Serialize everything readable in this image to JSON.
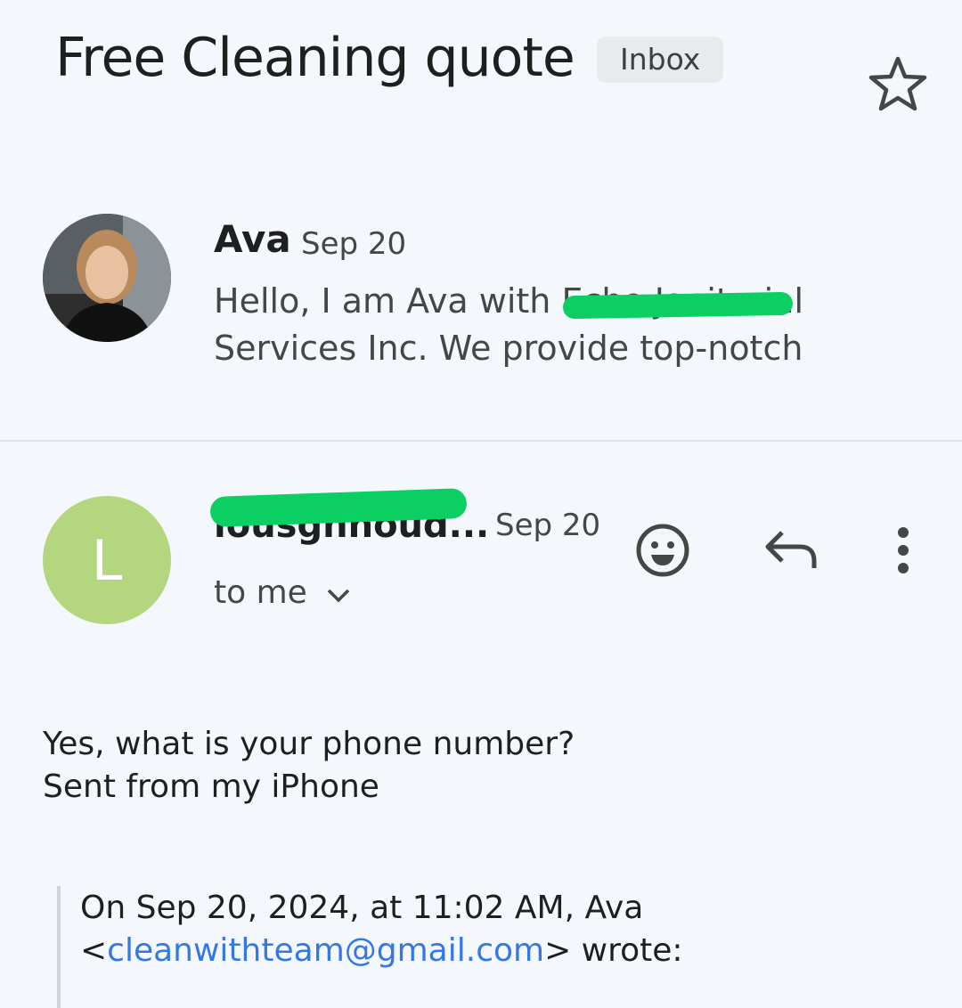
{
  "thread": {
    "subject": "Free Cleaning quote",
    "label": "Inbox",
    "star_icon": "star-outline-icon"
  },
  "collapsed_message": {
    "sender": "Ava",
    "date": "Sep 20",
    "snippet": "Hello, I am Ava with Echo Janitorial Services Inc. We provide top-notch"
  },
  "expanded_message": {
    "avatar_letter": "L",
    "avatar_color": "#b3d67f",
    "sender": "lousgnhoud...",
    "date": "Sep 20",
    "recipient": "to me",
    "actions": {
      "emoji_icon": "emoji-reaction-icon",
      "reply_icon": "reply-icon",
      "more_icon": "more-vert-icon"
    },
    "body": {
      "line1": "Yes, what is your phone number?",
      "line2": "Sent from my iPhone"
    },
    "quote": {
      "line1": "On Sep 20, 2024, at 11:02 AM, Ava",
      "email_open": "<",
      "email": "cleanwithteam@gmail.com",
      "email_close": "> wrote:"
    }
  },
  "colors": {
    "background": "#f4f8fc",
    "redaction": "#0ccf63",
    "link": "#3478e5"
  }
}
